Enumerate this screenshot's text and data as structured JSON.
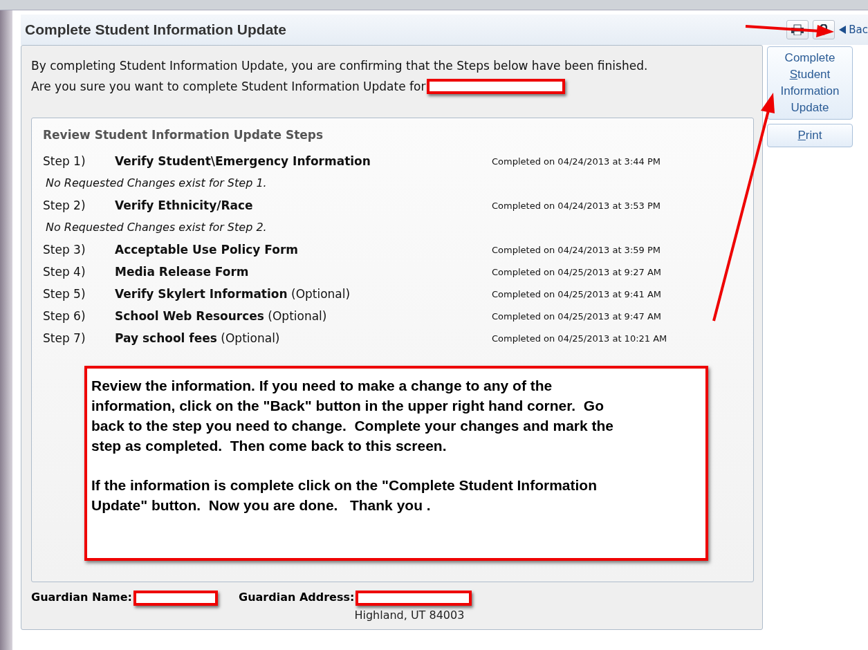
{
  "title": "Complete Student Information Update",
  "toolbar": {
    "back": "Bac"
  },
  "intro": [
    "By completing Student Information Update, you are confirming that the Steps below have been finished.",
    "Are you sure you want to complete Student Information Update for"
  ],
  "steps_panel": {
    "title": "Review Student Information Update Steps",
    "steps": [
      {
        "number": "Step 1)",
        "name": "Verify Student\\Emergency Information",
        "completed": "Completed on 04/24/2013 at 3:44 PM",
        "note": "No Requested Changes exist for Step 1."
      },
      {
        "number": "Step 2)",
        "name": "Verify Ethnicity/Race",
        "completed": "Completed on 04/24/2013 at 3:53 PM",
        "note": "No Requested Changes exist for Step 2."
      },
      {
        "number": "Step 3)",
        "name": "Acceptable Use Policy Form",
        "completed": "Completed on 04/24/2013 at 3:59 PM"
      },
      {
        "number": "Step 4)",
        "name": "Media Release Form",
        "completed": "Completed on 04/25/2013 at 9:27 AM"
      },
      {
        "number": "Step 5)",
        "name": "Verify Skylert Information",
        "suffix": "(Optional)",
        "completed": "Completed on 04/25/2013 at 9:41 AM"
      },
      {
        "number": "Step 6)",
        "name": "School Web Resources",
        "suffix": "(Optional)",
        "completed": "Completed on 04/25/2013 at 9:47 AM"
      },
      {
        "number": "Step 7)",
        "name": "Pay school fees",
        "suffix": "(Optional)",
        "completed": "Completed on 04/25/2013 at 10:21 AM"
      }
    ]
  },
  "callout": {
    "paragraphs": [
      "Review the information. If you need to make a change to any of the information, click on the \"Back\" button in the upper right hand corner.  Go back to the step you need to change.  Complete your changes and mark the step as completed.  Then come back to this screen.",
      "If the information is complete click on the \"Complete Student Information Update\" button.  Now you are done.   Thank you ."
    ]
  },
  "guardian": {
    "name_label": "Guardian Name:",
    "address_label": "Guardian Address:",
    "address_line": "Highland, UT 84003"
  },
  "side_buttons": [
    {
      "before": "Complete ",
      "key": "S",
      "after": "tudent Information Update"
    },
    {
      "key": "P",
      "after": "rint"
    }
  ]
}
